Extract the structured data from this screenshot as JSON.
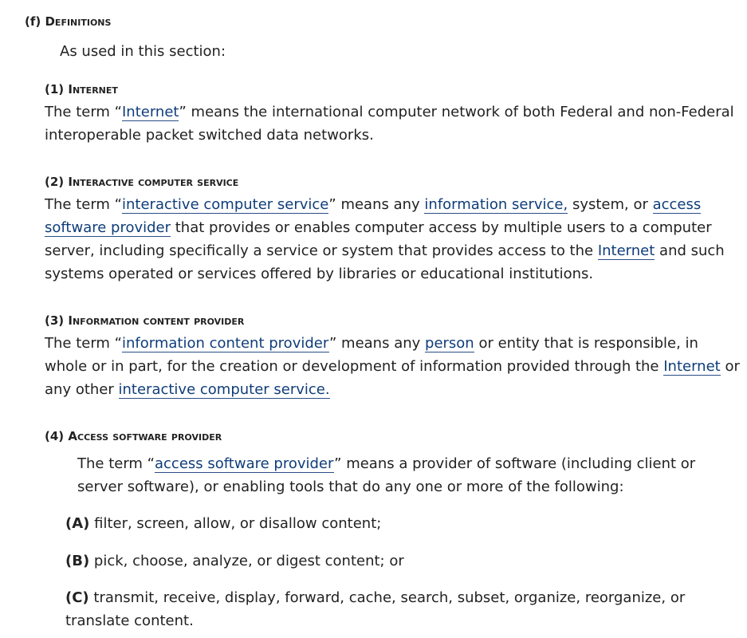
{
  "section": {
    "label": "(f)",
    "title": "Definitions",
    "intro": "As used in this section:"
  },
  "definitions": [
    {
      "num": "(1)",
      "title": "Internet",
      "parts": [
        "The term “",
        "Internet",
        "” means the international computer network of both Federal and non-Federal interoperable packet switched data networks."
      ]
    },
    {
      "num": "(2)",
      "title": "Interactive computer service",
      "parts": [
        "The term “",
        "interactive computer service",
        "” means any ",
        "information service,",
        " system, or ",
        "access software provider",
        " that provides or enables computer access by multiple users to a computer server, including specifically a service or system that provides access to the ",
        "Internet",
        " and such systems operated or services offered by libraries or educational institutions."
      ]
    },
    {
      "num": "(3)",
      "title": "Information content provider",
      "parts": [
        "The term “",
        "information content provider",
        "” means any ",
        "person",
        " or entity that is responsible, in whole or in part, for the creation or development of information provided through the ",
        "Internet",
        " or any other ",
        "interactive computer service."
      ]
    },
    {
      "num": "(4)",
      "title": "Access software provider",
      "parts": [
        "The term “",
        "access software provider",
        "” means a provider of software (including client or server software), or enabling tools that do any one or more of the following:"
      ]
    }
  ],
  "items": [
    {
      "label": "(A)",
      "text": " filter, screen, allow, or disallow content;"
    },
    {
      "label": "(B)",
      "text": " pick, choose, analyze, or digest content; or"
    },
    {
      "label": "(C)",
      "text": " transmit, receive, display, forward, cache, search, subset, organize, reorganize, or translate content."
    }
  ]
}
